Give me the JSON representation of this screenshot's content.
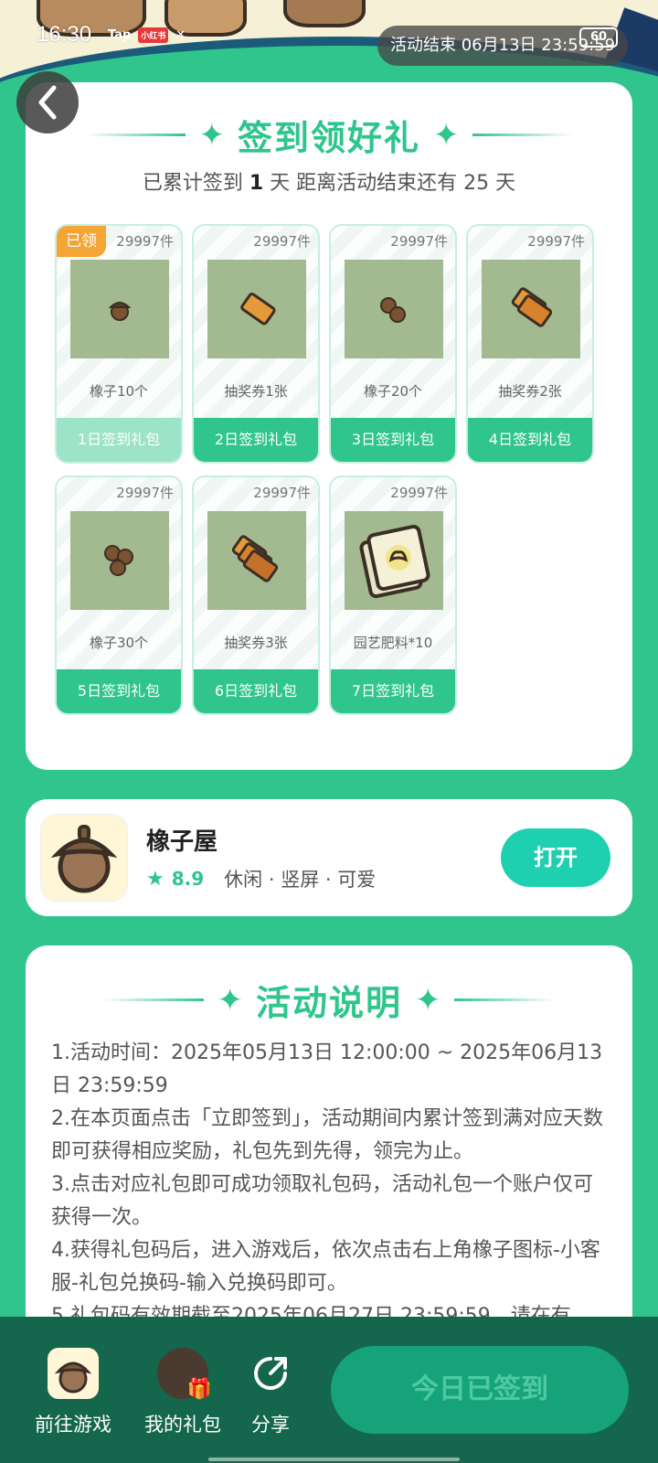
{
  "status_bar": {
    "time": "16:30",
    "icons": [
      "Tap",
      "小红书",
      "fan-icon"
    ],
    "battery": "60"
  },
  "banner": {
    "countdown": "活动结束 06月13日 23:59:59"
  },
  "signin": {
    "title": "签到领好礼",
    "summary_prefix": "已累计签到",
    "signed_days": "1",
    "summary_mid": "天  距离活动结束还有",
    "days_left": "25",
    "summary_suffix": "天",
    "claimed_tag": "已领",
    "gifts": [
      {
        "stock": "29997件",
        "name": "橡子10个",
        "label": "1日签到礼包",
        "claimed": true,
        "icon": "acorn-icon"
      },
      {
        "stock": "29997件",
        "name": "抽奖券1张",
        "label": "2日签到礼包",
        "claimed": false,
        "icon": "ticket-icon"
      },
      {
        "stock": "29997件",
        "name": "橡子20个",
        "label": "3日签到礼包",
        "claimed": false,
        "icon": "acorn-icon"
      },
      {
        "stock": "29997件",
        "name": "抽奖券2张",
        "label": "4日签到礼包",
        "claimed": false,
        "icon": "ticket-icon"
      },
      {
        "stock": "29997件",
        "name": "橡子30个",
        "label": "5日签到礼包",
        "claimed": false,
        "icon": "acorn-icon"
      },
      {
        "stock": "29997件",
        "name": "抽奖券3张",
        "label": "6日签到礼包",
        "claimed": false,
        "icon": "ticket-icon"
      },
      {
        "stock": "29997件",
        "name": "园艺肥料*10",
        "label": "7日签到礼包",
        "claimed": false,
        "icon": "fertilizer-icon"
      }
    ]
  },
  "app": {
    "name": "橡子屋",
    "rating": "8.9",
    "tags": "休闲 · 竖屏 · 可爱",
    "open_label": "打开"
  },
  "rules": {
    "title": "活动说明",
    "lines": [
      "1.活动时间：2025年05月13日 12:00:00 ~ 2025年06月13日 23:59:59",
      "2.在本页面点击「立即签到」，活动期间内累计签到满对应天数即可获得相应奖励，礼包先到先得，领完为止。",
      "3.点击对应礼包即可成功领取礼包码，活动礼包一个账户仅可获得一次。",
      "4.获得礼包码后，进入游戏后，依次点击右上角橡子图标-小客服-礼包兑换码-输入兑换码即可。",
      "5.礼包码有效期截至2025年06月27日 23:59:59，请在有"
    ]
  },
  "bottom_bar": {
    "go_game": "前往游戏",
    "my_gifts": "我的礼包",
    "share": "分享",
    "checked_in": "今日已签到"
  },
  "colors": {
    "accent": "#2fc58c",
    "claimed_badge": "#f4a535",
    "bottom_bar": "#14664c",
    "open_button": "#1ecfb0"
  }
}
